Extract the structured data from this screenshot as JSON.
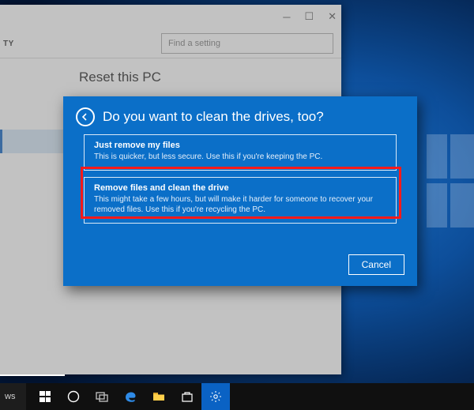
{
  "settings": {
    "header_left": "TY",
    "search_placeholder": "Find a setting",
    "page_heading": "Reset this PC"
  },
  "dialog": {
    "title": "Do you want to clean the drives, too?",
    "options": [
      {
        "title": "Just remove my files",
        "desc": "This is quicker, but less secure. Use this if you're keeping the PC."
      },
      {
        "title": "Remove files and clean the drive",
        "desc": "This might take a few hours, but will make it harder for someone to recover your removed files. Use this if you're recycling the PC."
      }
    ],
    "cancel": "Cancel"
  },
  "taskbar": {
    "label": "ws"
  }
}
